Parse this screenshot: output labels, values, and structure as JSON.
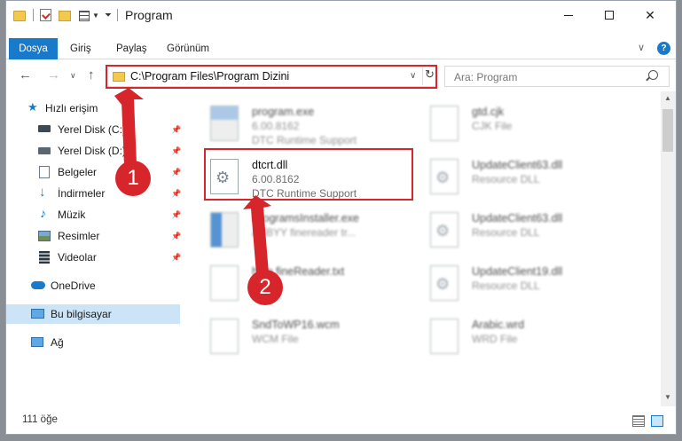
{
  "window": {
    "title": "Program"
  },
  "ribbon": {
    "tabs": [
      "Dosya",
      "Giriş",
      "Paylaş",
      "Görünüm"
    ]
  },
  "nav": {
    "address": "C:\\Program Files\\Program Dizini",
    "search_placeholder": "Ara: Program"
  },
  "sidebar": {
    "items": [
      {
        "label": "Hızlı erişim",
        "icon": "star-icon"
      },
      {
        "label": "Yerel Disk (C:)",
        "icon": "drive-icon"
      },
      {
        "label": "Yerel Disk (D:)",
        "icon": "drive-icon"
      },
      {
        "label": "Belgeler",
        "icon": "document-icon"
      },
      {
        "label": "İndirmeler",
        "icon": "download-icon"
      },
      {
        "label": "Müzik",
        "icon": "music-icon"
      },
      {
        "label": "Resimler",
        "icon": "pictures-icon"
      },
      {
        "label": "Videolar",
        "icon": "video-icon"
      },
      {
        "label": "OneDrive",
        "icon": "cloud-icon"
      },
      {
        "label": "Bu bilgisayar",
        "icon": "computer-icon"
      },
      {
        "label": "Ağ",
        "icon": "network-icon"
      }
    ]
  },
  "files": {
    "left": [
      {
        "name": "program.exe",
        "line1": "6.00.8162",
        "line2": "DTC Runtime Support"
      },
      {
        "name": "dtcrt.dll",
        "line1": "6.00.8162",
        "line2": "DTC Runtime Support"
      },
      {
        "name": "ProgramsInstaller.exe",
        "line1": "ABBYY finereader tr...",
        "line2": ""
      },
      {
        "name": "help.fineReader.txt",
        "line1": "",
        "line2": ""
      },
      {
        "name": "SndToWP16.wcm",
        "line1": "WCM File",
        "line2": ""
      }
    ],
    "right": [
      {
        "name": "gtd.cjk",
        "line1": "CJK File",
        "line2": ""
      },
      {
        "name": "UpdateClient63.dll",
        "line1": "Resource DLL",
        "line2": ""
      },
      {
        "name": "UpdateClient63.dll",
        "line1": "Resource DLL",
        "line2": ""
      },
      {
        "name": "UpdateClient19.dll",
        "line1": "Resource DLL",
        "line2": ""
      },
      {
        "name": "Arabic.wrd",
        "line1": "WRD File",
        "line2": ""
      }
    ]
  },
  "status": {
    "count": "111 öğe"
  },
  "annotations": {
    "marker1": "1",
    "marker2": "2",
    "color": "#d7262b"
  }
}
